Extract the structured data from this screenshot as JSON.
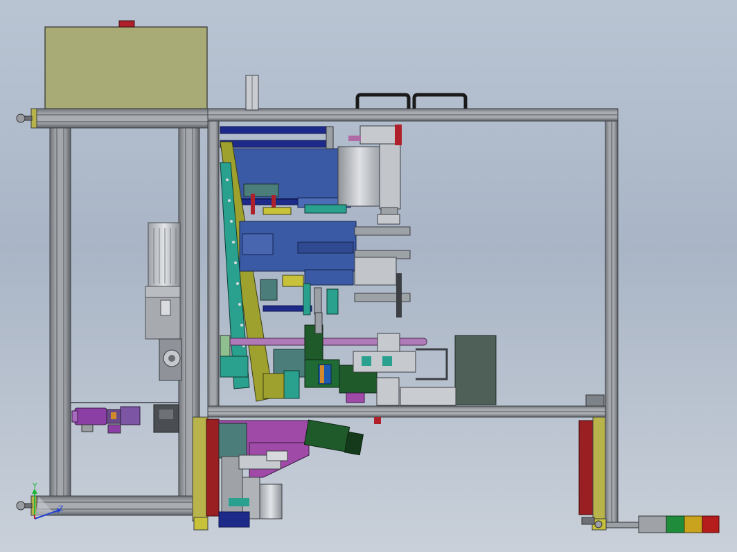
{
  "viewport": {
    "background_top": "#b9c4d3",
    "background_bottom": "#c9d0d9"
  },
  "triad": {
    "y_label": "Y",
    "z_label": "Z",
    "y_color": "#1fb83a",
    "z_color": "#2040d0"
  },
  "palette": {
    "frame": "#8e9297",
    "frame_dark": "#3c3f44",
    "tank": "#a9ab76",
    "motor": "#c9ccd1",
    "blue_block": "#3b5aa6",
    "navy_rod": "#1d2a8a",
    "olive": "#9ea12e",
    "teal": "#2aa08e",
    "purple": "#b07ab8",
    "magenta": "#a04aa8",
    "dark_green": "#1f5a2a",
    "red_guard": "#9a1f22",
    "yellow": "#c8c23a"
  },
  "signal_tower": {
    "segments": [
      "#9fa3a8",
      "#1e8c3a",
      "#c9a21e",
      "#b51c1c"
    ]
  }
}
